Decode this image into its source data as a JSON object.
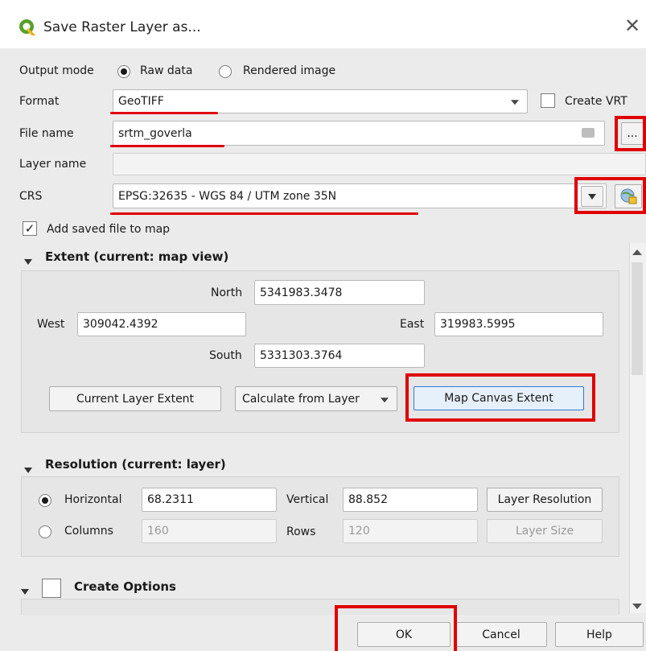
{
  "window": {
    "title": "Save Raster Layer as...",
    "close_glyph": "✕",
    "logo_icon": "qgis-logo-icon"
  },
  "output_mode": {
    "label": "Output mode",
    "options": [
      {
        "label": "Raw data",
        "selected": true
      },
      {
        "label": "Rendered image",
        "selected": false
      }
    ]
  },
  "format": {
    "label": "Format",
    "value": "GeoTIFF",
    "create_vrt_label": "Create VRT",
    "create_vrt_checked": false
  },
  "file_name": {
    "label": "File name",
    "value": "srtm_goverla",
    "browse_label": "..."
  },
  "layer_name": {
    "label": "Layer name",
    "value": ""
  },
  "crs": {
    "label": "CRS",
    "value": "EPSG:32635 - WGS 84 / UTM zone 35N",
    "select_icon": "globe-crs-icon"
  },
  "add_to_map": {
    "label": "Add saved file to map",
    "checked": true
  },
  "extent": {
    "title": "Extent (current: map view)",
    "north_label": "North",
    "north": "5341983.3478",
    "west_label": "West",
    "west": "309042.4392",
    "east_label": "East",
    "east": "319983.5995",
    "south_label": "South",
    "south": "5331303.3764",
    "current_layer_extent": "Current Layer Extent",
    "calculate_from_layer": "Calculate from Layer",
    "map_canvas_extent": "Map Canvas Extent"
  },
  "resolution": {
    "title": "Resolution (current: layer)",
    "horizontal_label": "Horizontal",
    "horizontal": "68.2311",
    "vertical_label": "Vertical",
    "vertical": "88.852",
    "layer_resolution": "Layer Resolution",
    "columns_label": "Columns",
    "columns": "160",
    "rows_label": "Rows",
    "rows": "120",
    "layer_size": "Layer Size",
    "mode": "horizontal"
  },
  "create_options": {
    "title": "Create Options",
    "checked": false
  },
  "buttons": {
    "ok": "OK",
    "cancel": "Cancel",
    "help": "Help"
  },
  "colors": {
    "highlight": "#e00000",
    "qgis_green": "#7fbf3f"
  }
}
